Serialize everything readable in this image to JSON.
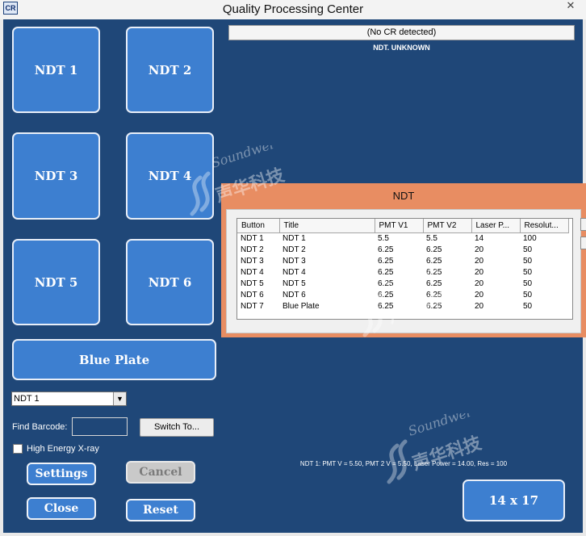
{
  "window": {
    "title": "Quality Processing Center",
    "app_icon_text": "CR",
    "close_glyph": "✕"
  },
  "ndt_buttons": [
    "NDT 1",
    "NDT 2",
    "NDT 3",
    "NDT 4",
    "NDT 5",
    "NDT 6"
  ],
  "blue_plate_label": "Blue Plate",
  "select": {
    "value": "NDT 1",
    "arrow": "▼"
  },
  "find_barcode": {
    "label": "Find Barcode:",
    "value": ""
  },
  "switch_button_label": "Switch To...",
  "high_energy_label": "High Energy X-ray",
  "actions": {
    "settings": "Settings",
    "cancel": "Cancel",
    "close": "Close",
    "reset": "Reset"
  },
  "status_text": "(No CR detected)",
  "ndt_status": "NDT. UNKNOWN",
  "info_text": "NDT 1: PMT V = 5.50, PMT 2 V = 5.50, Laser Power = 14.00, Res = 100",
  "size_button_label": "14 x 17",
  "popup": {
    "title": "NDT",
    "columns": [
      "Button",
      "Title",
      "PMT V1",
      "PMT V2",
      "Laser P...",
      "Resolut..."
    ],
    "rows": [
      [
        "NDT 1",
        "NDT 1",
        "5.5",
        "5.5",
        "14",
        "100"
      ],
      [
        "NDT 2",
        "NDT 2",
        "6.25",
        "6.25",
        "20",
        "50"
      ],
      [
        "NDT 3",
        "NDT 3",
        "6.25",
        "6.25",
        "20",
        "50"
      ],
      [
        "NDT 4",
        "NDT 4",
        "6.25",
        "6.25",
        "20",
        "50"
      ],
      [
        "NDT 5",
        "NDT 5",
        "6.25",
        "6.25",
        "20",
        "50"
      ],
      [
        "NDT 6",
        "NDT 6",
        "6.25",
        "6.25",
        "20",
        "50"
      ],
      [
        "NDT 7",
        "Blue Plate",
        "6.25",
        "6.25",
        "20",
        "50"
      ]
    ]
  },
  "watermark": {
    "script": "Soundwel",
    "chinese": "声华科技"
  },
  "colors": {
    "background": "#1f4778",
    "button": "#3d7fd0",
    "popup": "#e88d62"
  }
}
